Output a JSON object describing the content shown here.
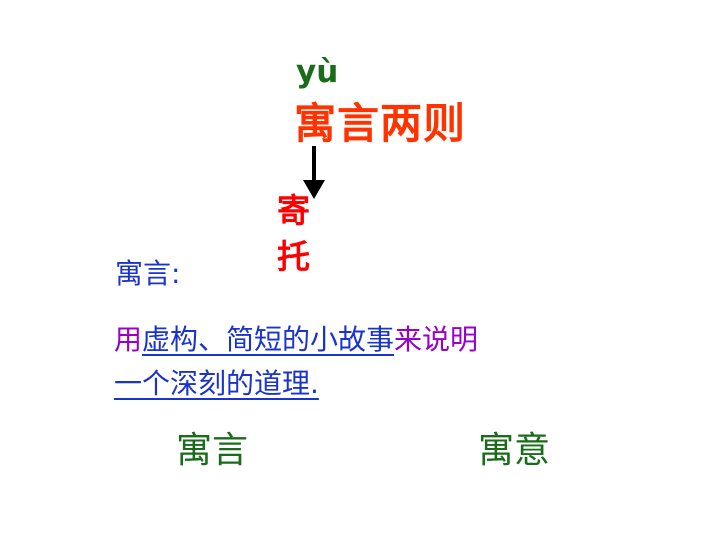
{
  "heading": {
    "pinyin": "yù",
    "title": "寓言两则"
  },
  "annotation": {
    "char_1": "寄",
    "char_2": "托"
  },
  "definition": {
    "label": "寓言:",
    "part_1": "用",
    "part_2": "虚构、简短的小故事",
    "part_3": "来说明",
    "part_4": "一个深刻的道理."
  },
  "terms": {
    "left": "寓言",
    "right": "寓意"
  },
  "colors": {
    "title": "#ff3300",
    "pinyin": "#1a6b1a",
    "annotation": "#ff0000",
    "definition_blue": "#1a33cc",
    "definition_purple": "#9900cc",
    "terms": "#1a6b1a"
  }
}
